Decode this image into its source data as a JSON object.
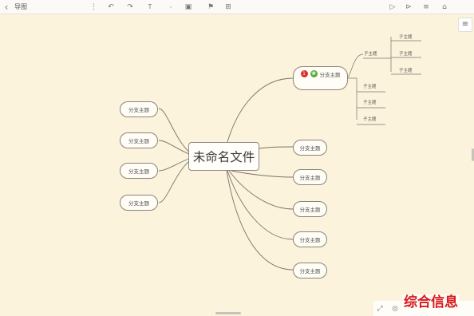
{
  "toolbar": {
    "back_icon": "‹",
    "title": "导图",
    "more_icon": "⋮",
    "undo_icon": "↶",
    "redo_icon": "↷",
    "text_icon": "T",
    "pin_icon": "⸳",
    "image_icon": "▣",
    "tag_icon": "⚑",
    "table_icon": "⊞",
    "play_icon": "▷",
    "present_icon": "⊳",
    "outline_icon": "≡",
    "lock_icon": "⌂",
    "user_name": "",
    "icon_names": [
      "back-icon",
      "more-icon",
      "undo-icon",
      "redo-icon",
      "text-icon",
      "pin-icon",
      "image-icon",
      "tag-icon",
      "table-icon",
      "play-icon",
      "present-icon",
      "outline-icon",
      "lock-icon"
    ]
  },
  "mindmap": {
    "central_topic": "未命名文件",
    "left_branches": [
      "分支主题",
      "分支主题",
      "分支主题",
      "分支主题"
    ],
    "right_branches": [
      "分支主题",
      "分支主题",
      "分支主题",
      "分支主题",
      "分支主题"
    ],
    "featured_branch": {
      "label": "分支主题",
      "priority_marker": "1",
      "note_left": "",
      "note_right": ""
    },
    "subtopics": [
      "子主题",
      "子主题",
      "子主题",
      "子主题",
      "子主题",
      "子主题",
      "子主题"
    ]
  },
  "side": {
    "panel_icon": "≡"
  },
  "bottom_tools": {
    "fit_icon": "⤢",
    "zoom_icon": "◎"
  },
  "watermark": "综合信息",
  "colors": {
    "canvas_bg": "#fbf3dc",
    "line": "#7a746a",
    "marker_red": "#d9302c",
    "marker_green": "#5aa83a",
    "watermark_red": "#d8191f"
  }
}
